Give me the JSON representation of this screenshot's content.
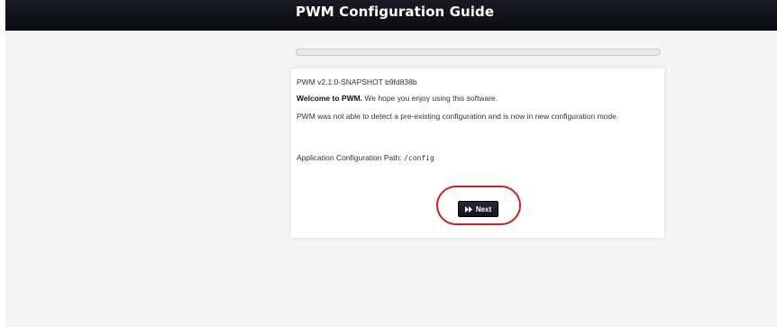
{
  "header": {
    "title": "PWM Configuration Guide"
  },
  "progress": {
    "percent": 0
  },
  "panel": {
    "version": "PWM v2.1.0-SNAPSHOT b9fd838b",
    "welcome_bold": "Welcome to PWM.",
    "welcome_rest": " We hope you enjoy using this software.",
    "detect_message": "PWM was not able to detect a pre-existing configuration and is now in new configuration mode.",
    "config_path_label": "Application Configuration Path: ",
    "config_path_value": "/config"
  },
  "buttons": {
    "next_label": "Next",
    "next_icon": "fast-forward-icon"
  },
  "colors": {
    "header_bg": "#0b0b14",
    "highlight": "#cc1f1f",
    "button_bg": "#14141c"
  }
}
